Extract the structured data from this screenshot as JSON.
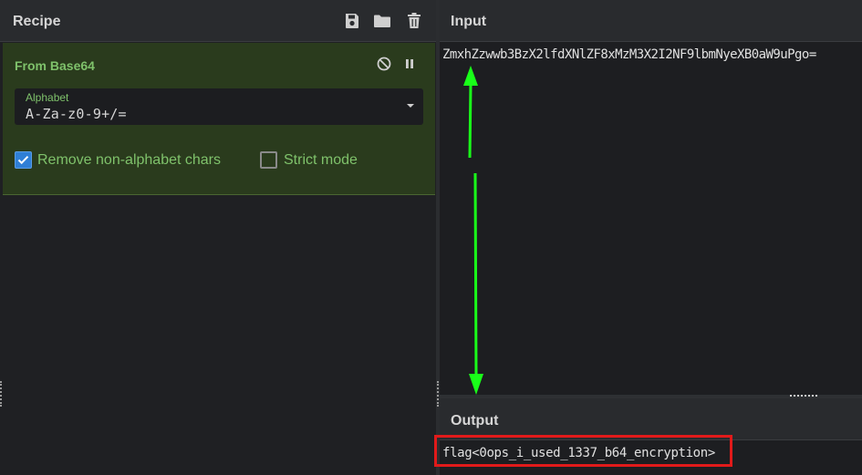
{
  "recipe": {
    "title": "Recipe",
    "icons": {
      "save": "save-icon",
      "open": "folder-icon",
      "clear": "trash-icon"
    },
    "operation": {
      "name": "From Base64",
      "icons": {
        "disable": "disable-icon",
        "pause": "pause-icon"
      },
      "alphabet_label": "Alphabet",
      "alphabet_value": "A-Za-z0-9+/=",
      "remove_non_alphabet_label": "Remove non-alphabet chars",
      "remove_non_alphabet_checked": true,
      "strict_mode_label": "Strict mode",
      "strict_mode_checked": false
    }
  },
  "input": {
    "title": "Input",
    "value": "ZmxhZzwwb3BzX2lfdXNlZF8xMzM3X2I2NF9lbmNyeXB0aW9uPgo="
  },
  "output": {
    "title": "Output",
    "value": "flag<0ops_i_used_1337_b64_encryption>"
  },
  "colors": {
    "accent_green": "#7fc26b",
    "annotation_arrow": "#19ff19",
    "annotation_box": "#e11a1a",
    "checkbox_blue": "#2f7fd6"
  }
}
